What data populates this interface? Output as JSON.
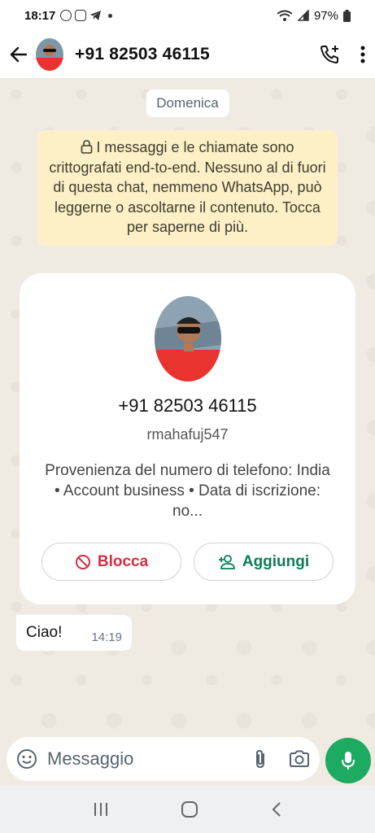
{
  "status_bar": {
    "time": "18:17",
    "battery": "97%"
  },
  "header": {
    "contact": "+91 82503 46115"
  },
  "chat": {
    "date_chip": "Domenica",
    "e2e_notice": "I messaggi e le chiamate sono crittografati end-to-end. Nessuno al di fuori di questa chat, nemmeno WhatsApp, può leggerne o ascoltarne il contenuto. Tocca per saperne di più."
  },
  "contact_card": {
    "number": "+91 82503 46115",
    "username": "rmahafuj547",
    "info": "Provenienza del numero di telefono: India • Account business • Data di iscrizione: no...",
    "block_label": "Blocca",
    "add_label": "Aggiungi"
  },
  "messages": [
    {
      "text": "Ciao!",
      "time": "14:19"
    }
  ],
  "input": {
    "placeholder": "Messaggio"
  },
  "colors": {
    "accent": "#1daa61",
    "block": "#d32f43",
    "add": "#0a7e55",
    "notice_bg": "#fdf0c7",
    "chat_bg": "#efeae2"
  },
  "icons": [
    "whatsapp-icon",
    "instagram-icon",
    "telegram-icon",
    "wifi-icon",
    "signal-icon",
    "battery-icon",
    "back-arrow-icon",
    "add-call-icon",
    "more-vert-icon",
    "lock-icon",
    "block-icon",
    "person-add-icon",
    "emoji-icon",
    "attach-icon",
    "camera-icon",
    "mic-icon",
    "recents-icon",
    "home-icon",
    "back-nav-icon"
  ]
}
